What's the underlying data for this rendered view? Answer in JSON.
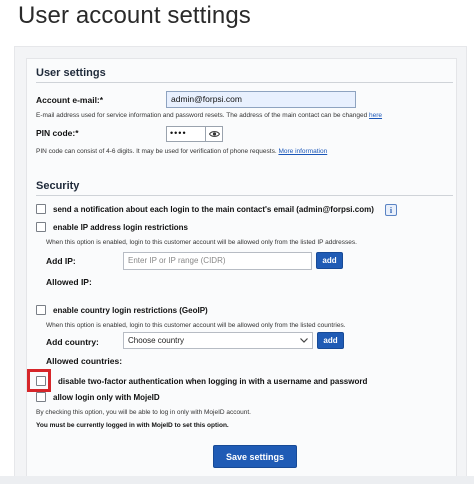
{
  "page": {
    "title": "User account settings"
  },
  "user_settings": {
    "section_title": "User settings",
    "email": {
      "label": "Account e-mail:*",
      "value": "admin@forpsi.com",
      "hint": "E-mail address used for service information and password resets. The address of the main contact can be changed",
      "hint_link": "here"
    },
    "pin": {
      "label": "PIN code:*",
      "value": "••••",
      "hint": "PIN code can consist of 4-6 digits. It may be used for verification of phone requests.",
      "hint_link": "More information"
    }
  },
  "security": {
    "section_title": "Security",
    "notify_login": {
      "label": "send a notification about each login to the main contact's email (admin@forpsi.com)",
      "checked": false
    },
    "ip_restrictions": {
      "label": "enable IP address login restrictions",
      "checked": false,
      "hint": "When this option is enabled, login to this customer account will be allowed only from the listed IP addresses.",
      "add_label": "Add IP:",
      "placeholder": "Enter IP or IP range (CIDR)",
      "add_button": "add",
      "allowed_label": "Allowed IP:"
    },
    "country_restrictions": {
      "label": "enable country login restrictions (GeoIP)",
      "checked": false,
      "hint": "When this option is enabled, login to this customer account will be allowed only from the listed countries.",
      "add_label": "Add country:",
      "select_value": "Choose country",
      "add_button": "add",
      "allowed_label": "Allowed countries:"
    },
    "disable_2fa": {
      "label": "disable two-factor authentication when logging in with a username and password",
      "checked": false
    },
    "mojeid": {
      "label": "allow login only with MojeID",
      "checked": false,
      "hint": "By checking this option, you will be able to log in only with MojeID account.",
      "note": "You must be currently logged in with MojeID to set this option."
    }
  },
  "actions": {
    "save_label": "Save settings"
  },
  "colors": {
    "primary": "#1f5bb5",
    "highlight": "#d6262a",
    "input_autofill": "#e8f0fe"
  },
  "icons": {
    "pin_toggle": "eye-icon",
    "info": "info-icon",
    "select": "chevron-down-icon"
  }
}
